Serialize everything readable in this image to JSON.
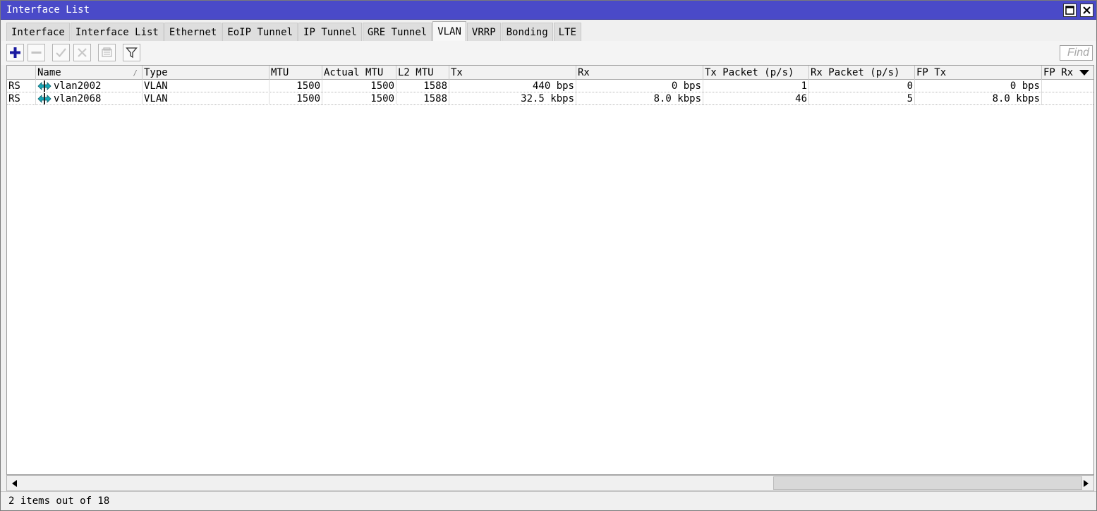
{
  "window": {
    "title": "Interface List"
  },
  "tabs": [
    {
      "label": "Interface",
      "active": false
    },
    {
      "label": "Interface List",
      "active": false
    },
    {
      "label": "Ethernet",
      "active": false
    },
    {
      "label": "EoIP Tunnel",
      "active": false
    },
    {
      "label": "IP Tunnel",
      "active": false
    },
    {
      "label": "GRE Tunnel",
      "active": false
    },
    {
      "label": "VLAN",
      "active": true
    },
    {
      "label": "VRRP",
      "active": false
    },
    {
      "label": "Bonding",
      "active": false
    },
    {
      "label": "LTE",
      "active": false
    }
  ],
  "toolbar": {
    "buttons": [
      "plus-icon",
      "minus-icon",
      "check-icon",
      "x-icon",
      "comment-icon",
      "filter-icon"
    ],
    "find_placeholder": "Find"
  },
  "table": {
    "columns": [
      "",
      "Name",
      "Type",
      "MTU",
      "Actual MTU",
      "L2 MTU",
      "Tx",
      "Rx",
      "Tx Packet (p/s)",
      "Rx Packet (p/s)",
      "FP Tx",
      "FP Rx"
    ],
    "rows": [
      {
        "flags": "RS",
        "name": "vlan2002",
        "type": "VLAN",
        "mtu": "1500",
        "actual_mtu": "1500",
        "l2_mtu": "1588",
        "tx": "440 bps",
        "rx": "0 bps",
        "tx_packet": "1",
        "rx_packet": "0",
        "fp_tx": "0 bps",
        "fp_rx": ""
      },
      {
        "flags": "RS",
        "name": "vlan2068",
        "type": "VLAN",
        "mtu": "1500",
        "actual_mtu": "1500",
        "l2_mtu": "1588",
        "tx": "32.5 kbps",
        "rx": "8.0 kbps",
        "tx_packet": "46",
        "rx_packet": "5",
        "fp_tx": "8.0 kbps",
        "fp_rx": ""
      }
    ]
  },
  "status": {
    "text": "2 items out of 18"
  },
  "colors": {
    "titlebar": "#4a4ac8",
    "plus": "#1a1aa0",
    "vlan_icon": "#18a8b8"
  }
}
